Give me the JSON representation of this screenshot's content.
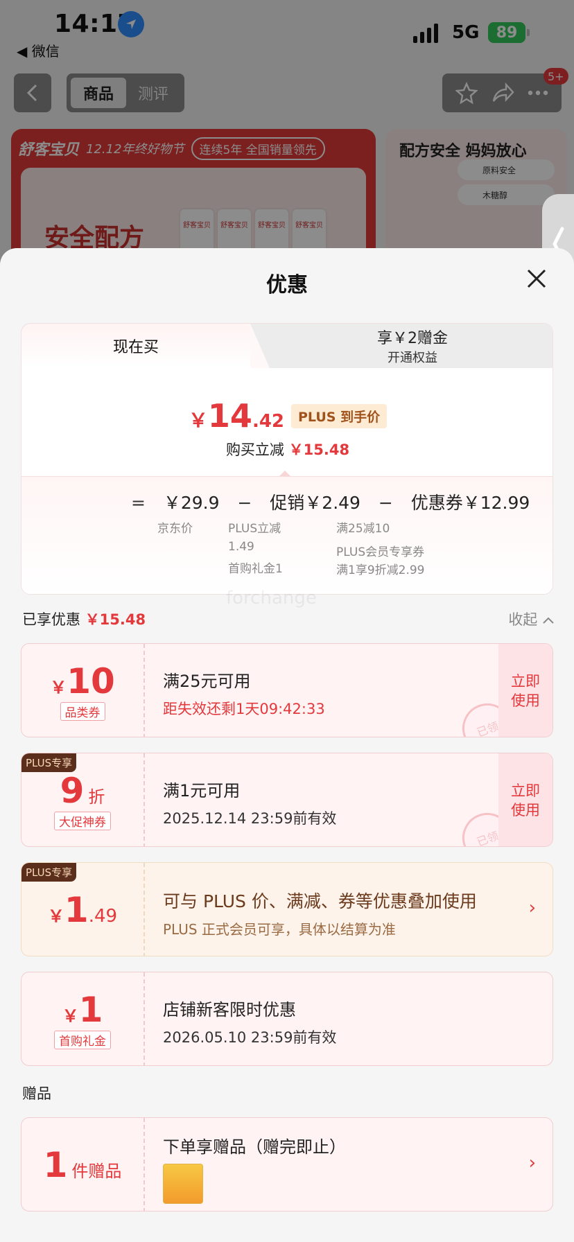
{
  "status_bar": {
    "time": "14:17",
    "back_app": "◀ 微信",
    "network": "5G",
    "battery": "89"
  },
  "nav": {
    "tabs": [
      "商品",
      "测评"
    ],
    "badge": "5+"
  },
  "banner": {
    "brand": "舒客宝贝",
    "event": "12.12年终好物节",
    "slogan": "连续5年 全国销量领先",
    "product_title": "安全配方",
    "product_labels": [
      "舒客宝贝",
      "舒客宝贝",
      "舒客宝贝",
      "舒客宝贝"
    ],
    "right_title": "配方安全 妈妈放心",
    "right_items": [
      "原料安全",
      "木糖醇"
    ]
  },
  "sheet": {
    "title": "优惠",
    "tabs": {
      "buy_now": "现在买",
      "plus_main": "享￥2赠金",
      "plus_sub": "开通权益"
    },
    "price": {
      "yen": "￥",
      "integer": "14",
      "decimal": ".42",
      "tag": "PLUS 到手价",
      "save_label": "购买立减",
      "save_amount": "￥15.48"
    },
    "breakdown": {
      "equals": "=",
      "jd_price": "￥29.9",
      "minus1": "−",
      "promo": "促销￥2.49",
      "minus2": "−",
      "coupon": "优惠券￥12.99",
      "jd_label": "京东价",
      "promo_items": [
        "PLUS立减",
        "1.49",
        "首购礼金1"
      ],
      "coupon_items": [
        "满25减10",
        "PLUS会员专享券",
        "满1享9折减2.99"
      ]
    },
    "enjoyed": {
      "label": "已享优惠",
      "amount": "￥15.48",
      "collapse": "收起"
    },
    "coupons": [
      {
        "yen": "￥",
        "amount": "10",
        "type": "品类券",
        "condition": "满25元可用",
        "sub": "距失效还剩1天09:42:33",
        "action": "立即使用",
        "stamp": "已领"
      },
      {
        "corner": "PLUS专享",
        "amount": "9",
        "unit": "折",
        "type": "大促神券",
        "condition": "满1元可用",
        "sub": "2025.12.14 23:59前有效",
        "action": "立即使用",
        "stamp": "已领"
      },
      {
        "corner": "PLUS专享",
        "yen": "￥",
        "amount": "1",
        "decimal": ".49",
        "condition": "可与 PLUS 价、满减、券等优惠叠加使用",
        "sub": "PLUS 正式会员可享，具体以结算为准"
      },
      {
        "yen": "￥",
        "amount": "1",
        "type": "首购礼金",
        "condition": "店铺新客限时优惠",
        "sub": "2026.05.10 23:59前有效"
      }
    ],
    "gift_section": {
      "title": "赠品",
      "count": "1",
      "unit": "件赠品",
      "condition": "下单享赠品（赠完即止）"
    },
    "watermark": "forchange"
  },
  "colors": {
    "accent_red": "#e4393c",
    "plus_brown": "#5a2e1b",
    "plus_gold_bg": "#fdf3ea"
  }
}
